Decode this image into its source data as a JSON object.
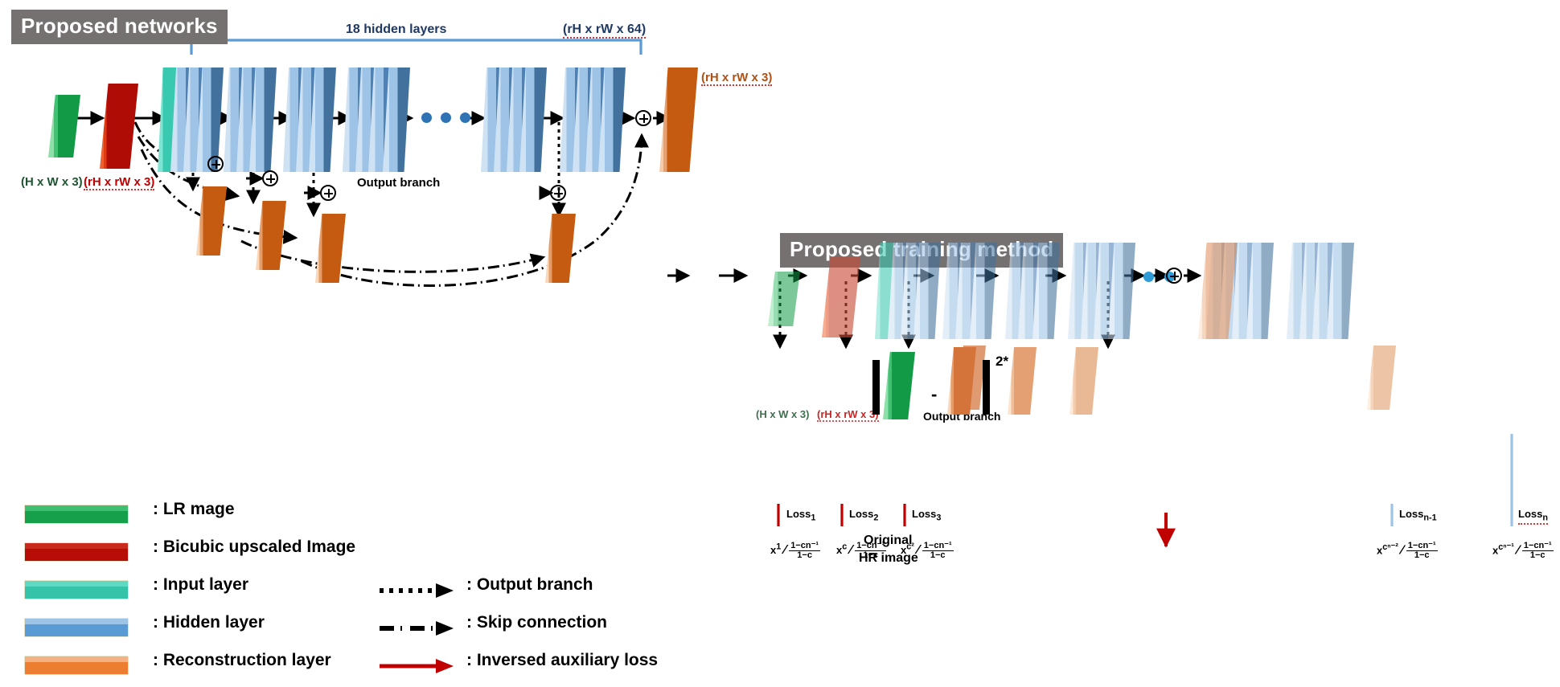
{
  "sections": {
    "networks_title": "Proposed networks",
    "training_title": "Proposed training method"
  },
  "top_diagram": {
    "bracket_label": "18 hidden layers",
    "feature_dim_label": "(rH x rW x 64)",
    "output_dim_label": "(rH x rW x 3)",
    "input_label": "(H x W x 3)",
    "bicubic_label": "(rH x rW x 3)",
    "output_branch_label": "Output branch",
    "ellipsis_dots": 3
  },
  "bottom_diagram": {
    "input_label": "(H x W x 3)",
    "bicubic_label": "(rH x rW x 3)",
    "output_branch_label": "Output branch",
    "original_hr_line1": "Original",
    "original_hr_line2": "HR image",
    "minus_symbol": "-",
    "power_symbol": "2*",
    "losses": [
      {
        "name": "Loss",
        "sub": "1",
        "base": "x",
        "exp": "1"
      },
      {
        "name": "Loss",
        "sub": "2",
        "base": "x",
        "exp": "c"
      },
      {
        "name": "Loss",
        "sub": "3",
        "base": "x",
        "exp": "c²"
      },
      {
        "name": "Loss",
        "sub": "n-1",
        "base": "x",
        "exp": "cⁿ⁻²"
      },
      {
        "name": "Loss",
        "sub": "n",
        "base": "x",
        "exp": "cⁿ⁻¹"
      }
    ],
    "fraction_numerator": "1−cn⁻¹",
    "fraction_denominator": "1−c"
  },
  "legend": {
    "items": [
      {
        "label": ": LR mage",
        "icon": "green-slab-icon",
        "top": "#3FBF6F",
        "bottom": "#17A04B"
      },
      {
        "label": ": Bicubic  upscaled Image",
        "icon": "red-slab-icon",
        "top": "#C92A1E",
        "bottom": "#B80C06"
      },
      {
        "label": ": Input layer",
        "icon": "teal-slab-icon",
        "top": "#5FD9C4",
        "bottom": "#35C3AA"
      },
      {
        "label": ": Hidden layer",
        "icon": "blue-slab-icon",
        "top": "#9DC3E6",
        "bottom": "#5B9BD5"
      },
      {
        "label": ": Reconstruction layer",
        "icon": "orange-slab-icon",
        "top": "#F4B183",
        "bottom": "#ED7D31"
      }
    ],
    "arrows": [
      {
        "label": ": Output branch",
        "style": "dotted",
        "icon": "dotted-arrow-icon",
        "color": "#000000"
      },
      {
        "label": ": Skip connection",
        "style": "dashdot",
        "icon": "dashdot-arrow-icon",
        "color": "#000000"
      },
      {
        "label": ": Inversed auxiliary loss",
        "style": "solid",
        "icon": "red-arrow-icon",
        "color": "#C00000"
      }
    ]
  },
  "colors": {
    "chip_bg": "#767171",
    "navy_text": "#1F3864",
    "green_text": "#1E5631",
    "red_text": "#C00000",
    "orange_text": "#B25014",
    "bracket_blue": "#5B9BD5",
    "loss_red": "#C00000",
    "loss_blue": "#9DC3E6"
  }
}
